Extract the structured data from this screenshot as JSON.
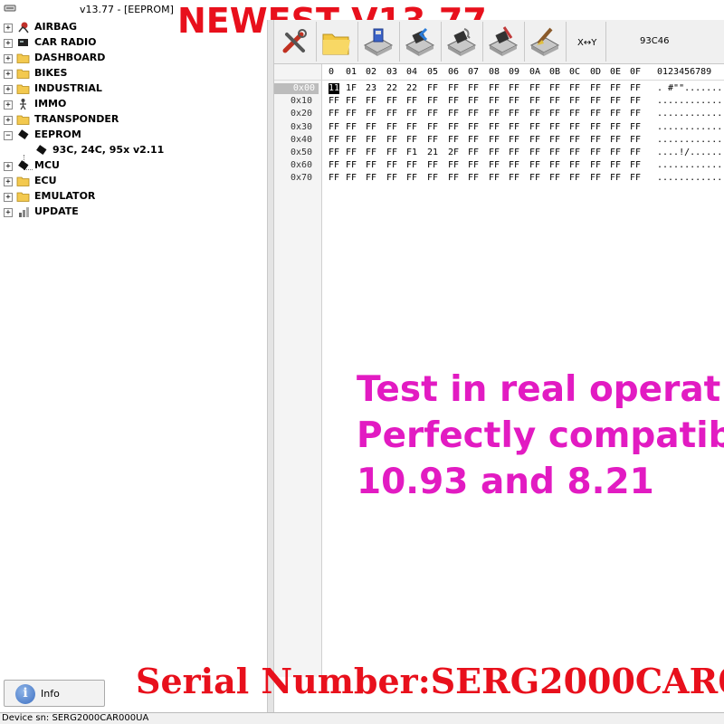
{
  "window": {
    "title": "v13.77 - [EEPROM]",
    "promo_title": "NEWEST V13.77"
  },
  "tree": {
    "items": [
      {
        "label": "AIRBAG",
        "expander": "+",
        "icon": "airbag-icon"
      },
      {
        "label": "CAR RADIO",
        "expander": "+",
        "icon": "radio-icon"
      },
      {
        "label": "DASHBOARD",
        "expander": "+",
        "icon": "folder-icon"
      },
      {
        "label": "BIKES",
        "expander": "+",
        "icon": "folder-icon"
      },
      {
        "label": "INDUSTRIAL",
        "expander": "+",
        "icon": "folder-icon"
      },
      {
        "label": "IMMO",
        "expander": "+",
        "icon": "immo-icon"
      },
      {
        "label": "TRANSPONDER",
        "expander": "+",
        "icon": "folder-icon"
      },
      {
        "label": "EEPROM",
        "expander": "−",
        "icon": "chip-icon"
      },
      {
        "label": "93C, 24C, 95x v2.11",
        "expander": "",
        "icon": "chip-icon"
      },
      {
        "label": "MCU",
        "expander": "+",
        "icon": "chip-icon"
      },
      {
        "label": "ECU",
        "expander": "+",
        "icon": "folder-icon"
      },
      {
        "label": "EMULATOR",
        "expander": "+",
        "icon": "folder-icon"
      },
      {
        "label": "UPDATE",
        "expander": "+",
        "icon": "update-icon"
      }
    ]
  },
  "toolbar": {
    "swap_label": "X↔Y",
    "chip_label": "93C46",
    "buttons": [
      "tools-icon",
      "open-folder-icon",
      "save-icon",
      "read-icon",
      "verify-icon",
      "write-icon",
      "erase-icon"
    ]
  },
  "hex": {
    "columns": [
      "0",
      "01",
      "02",
      "03",
      "04",
      "05",
      "06",
      "07",
      "08",
      "09",
      "0A",
      "0B",
      "0C",
      "0D",
      "0E",
      "0F"
    ],
    "ascii_header": "0123456789",
    "rows": [
      {
        "addr": "0x00",
        "bytes": [
          "11",
          "1F",
          "23",
          "22",
          "22",
          "FF",
          "FF",
          "FF",
          "FF",
          "FF",
          "FF",
          "FF",
          "FF",
          "FF",
          "FF",
          "FF"
        ],
        "ascii": ". #\"\"..........."
      },
      {
        "addr": "0x10",
        "bytes": [
          "FF",
          "FF",
          "FF",
          "FF",
          "FF",
          "FF",
          "FF",
          "FF",
          "FF",
          "FF",
          "FF",
          "FF",
          "FF",
          "FF",
          "FF",
          "FF"
        ],
        "ascii": "................"
      },
      {
        "addr": "0x20",
        "bytes": [
          "FF",
          "FF",
          "FF",
          "FF",
          "FF",
          "FF",
          "FF",
          "FF",
          "FF",
          "FF",
          "FF",
          "FF",
          "FF",
          "FF",
          "FF",
          "FF"
        ],
        "ascii": "................"
      },
      {
        "addr": "0x30",
        "bytes": [
          "FF",
          "FF",
          "FF",
          "FF",
          "FF",
          "FF",
          "FF",
          "FF",
          "FF",
          "FF",
          "FF",
          "FF",
          "FF",
          "FF",
          "FF",
          "FF"
        ],
        "ascii": "................"
      },
      {
        "addr": "0x40",
        "bytes": [
          "FF",
          "FF",
          "FF",
          "FF",
          "FF",
          "FF",
          "FF",
          "FF",
          "FF",
          "FF",
          "FF",
          "FF",
          "FF",
          "FF",
          "FF",
          "FF"
        ],
        "ascii": "................"
      },
      {
        "addr": "0x50",
        "bytes": [
          "FF",
          "FF",
          "FF",
          "FF",
          "F1",
          "21",
          "2F",
          "FF",
          "FF",
          "FF",
          "FF",
          "FF",
          "FF",
          "FF",
          "FF",
          "FF"
        ],
        "ascii": "....!/.........."
      },
      {
        "addr": "0x60",
        "bytes": [
          "FF",
          "FF",
          "FF",
          "FF",
          "FF",
          "FF",
          "FF",
          "FF",
          "FF",
          "FF",
          "FF",
          "FF",
          "FF",
          "FF",
          "FF",
          "FF"
        ],
        "ascii": "................"
      },
      {
        "addr": "0x70",
        "bytes": [
          "FF",
          "FF",
          "FF",
          "FF",
          "FF",
          "FF",
          "FF",
          "FF",
          "FF",
          "FF",
          "FF",
          "FF",
          "FF",
          "FF",
          "FF",
          "FF"
        ],
        "ascii": "................"
      }
    ]
  },
  "overlay": {
    "lines": [
      "Test in real operat",
      "Perfectly compatib",
      "10.93 and 8.21"
    ],
    "serial": "Serial Number:SERG2000CAR0"
  },
  "info_button": {
    "label": "Info"
  },
  "status": {
    "device": "Device sn: SERG2000CAR000UA"
  },
  "colors": {
    "promo_red": "#e8101c",
    "overlay_magenta": "#e21bc2",
    "selected_row": "#bcbcbc"
  }
}
